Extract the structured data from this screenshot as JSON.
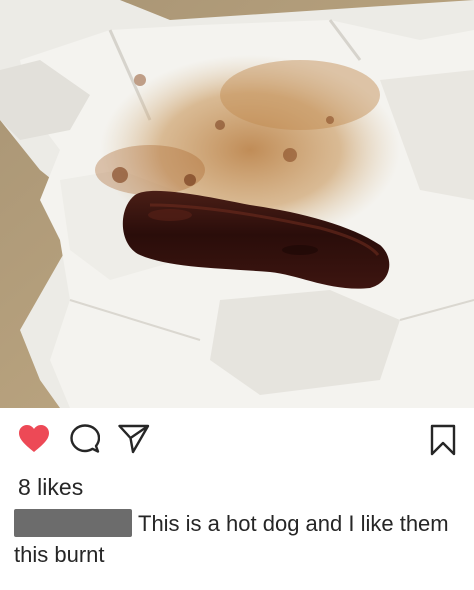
{
  "post": {
    "likes_text": "8 likes",
    "caption_text": "This is a hot dog and I like them this burnt",
    "username_redacted": true
  },
  "icons": {
    "like": "heart-icon-filled",
    "comment": "comment-bubble-icon",
    "share": "paper-plane-icon",
    "save": "bookmark-icon"
  },
  "colors": {
    "like_red": "#ed4956",
    "text": "#262626",
    "redaction": "#6c6c6c"
  }
}
